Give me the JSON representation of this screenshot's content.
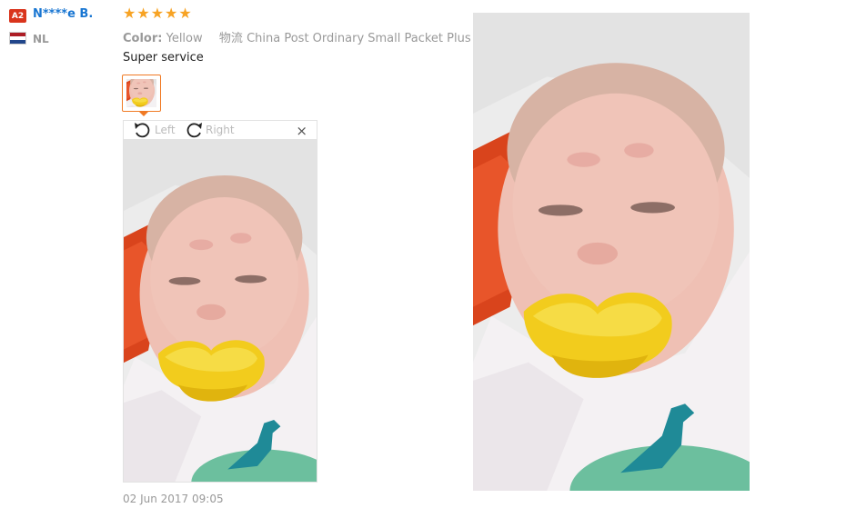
{
  "reviewer": {
    "badge": "A2",
    "name": "N****e B.",
    "country": "NL"
  },
  "rating": {
    "stars": 5
  },
  "meta": {
    "color_label": "Color:",
    "color_value": "Yellow",
    "shipping_label": "物流",
    "shipping_value": "China Post Ordinary Small Packet Plus"
  },
  "review_text": "Super service",
  "viewer": {
    "rotate_left": "Left",
    "rotate_right": "Right",
    "close": "×"
  },
  "date": "02 Jun 2017 09:05",
  "colors": {
    "star": "#f7a324",
    "name": "#1976d2",
    "badge": "#d9341c",
    "thumb_border": "#f07a24"
  },
  "icons": [
    "rotate-left-icon",
    "rotate-right-icon",
    "close-icon",
    "star-icon",
    "nl-flag-icon"
  ]
}
